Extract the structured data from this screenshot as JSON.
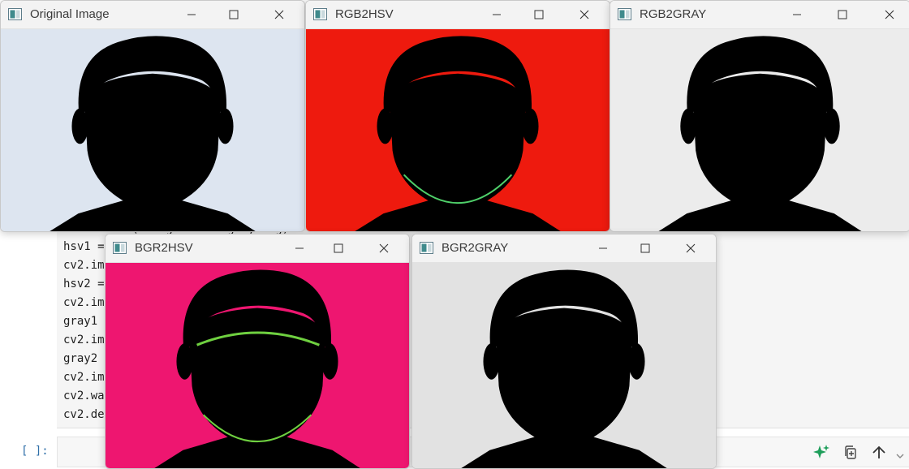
{
  "notebook": {
    "code_lines": [
      {
        "text": "cv2.imshow('Original Image', img)",
        "y": 0
      },
      {
        "text": "hsv1 = ",
        "y": 1
      },
      {
        "text": "cv2.im",
        "y": 2
      },
      {
        "text": "hsv2 = ",
        "y": 3
      },
      {
        "text": "cv2.im",
        "y": 4
      },
      {
        "text": "gray1",
        "y": 5
      },
      {
        "text": "cv2.im",
        "y": 6
      },
      {
        "text": "gray2",
        "y": 7
      },
      {
        "text": "cv2.im",
        "y": 8
      },
      {
        "text": "cv2.wa",
        "y": 9
      },
      {
        "text": "cv2.de",
        "y": 10
      }
    ],
    "prompt": "[ ]:",
    "toolbar": {
      "ai": "sparkle-icon",
      "copy": "duplicate-icon",
      "up": "arrow-up-icon",
      "more": "chevron-down-icon"
    }
  },
  "windows": [
    {
      "title": "Original Image",
      "filter": "original"
    },
    {
      "title": "RGB2HSV",
      "filter": "rgb2hsv"
    },
    {
      "title": "RGB2GRAY",
      "filter": "gray"
    },
    {
      "title": "BGR2HSV",
      "filter": "bgr2hsv"
    },
    {
      "title": "BGR2GRAY",
      "filter": "gray2"
    }
  ],
  "colors": {
    "original_bg": "#dde5f0",
    "rgb2hsv_bg": "#ee1a0e",
    "gray_bg": "#ececec",
    "bgr2hsv_bg": "#ee1670",
    "gray2_bg": "#e2e2e2",
    "prompt": "#2f6fa8",
    "ai_icon": "#1e9e5a"
  }
}
